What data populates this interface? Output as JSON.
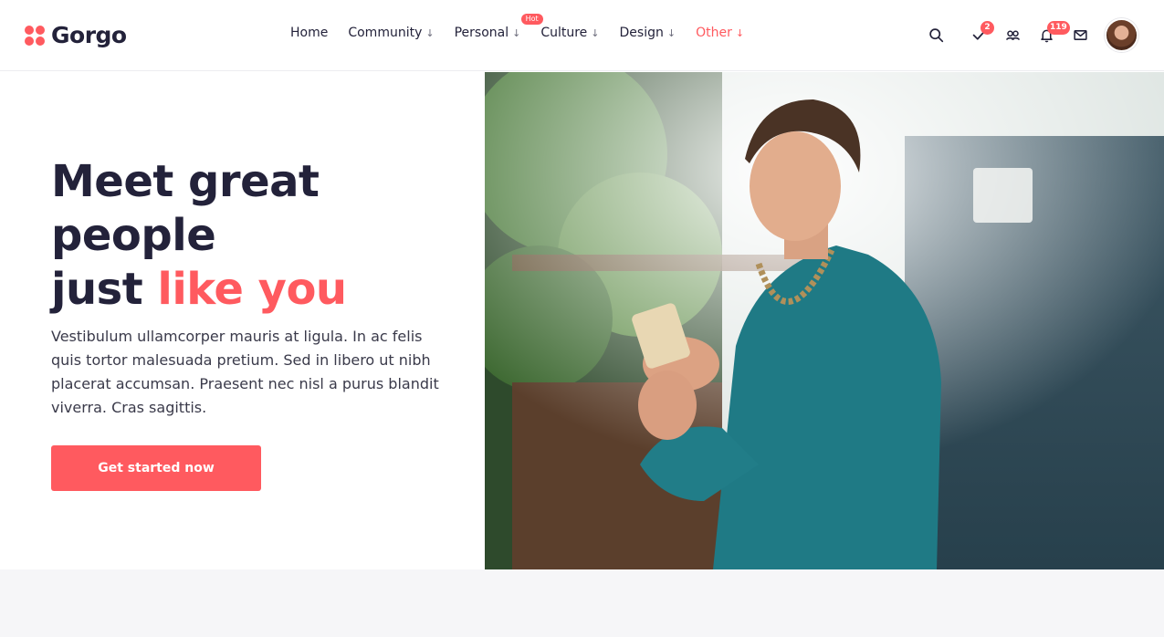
{
  "brand": {
    "name": "Gorgo",
    "color": "#ff5a5f"
  },
  "nav": {
    "items": [
      {
        "label": "Home",
        "has_dropdown": false
      },
      {
        "label": "Community",
        "has_dropdown": true
      },
      {
        "label": "Personal",
        "has_dropdown": true,
        "badge": "Hot"
      },
      {
        "label": "Culture",
        "has_dropdown": true
      },
      {
        "label": "Design",
        "has_dropdown": true
      },
      {
        "label": "Other",
        "has_dropdown": true,
        "highlighted": true
      }
    ],
    "dropdown_glyph": "↓"
  },
  "header_icons": {
    "search": {
      "icon": "search-icon"
    },
    "tasks": {
      "icon": "check-icon",
      "count": "2"
    },
    "friends": {
      "icon": "users-icon"
    },
    "notifications": {
      "icon": "bell-icon",
      "count": "119"
    },
    "messages": {
      "icon": "envelope-icon"
    },
    "profile": {
      "icon": "avatar"
    }
  },
  "hero": {
    "headline_line1": "Meet great",
    "headline_line2": "people",
    "headline_line3_plain": "just ",
    "headline_line3_accent": "like you",
    "description": "Vestibulum ullamcorper mauris at ligula. In ac felis quis tortor malesuada pretium. Sed in libero ut nibh placerat accumsan. Praesent nec nisl a purus blandit viverra. Cras sagittis.",
    "cta_label": "Get started now"
  },
  "colors": {
    "accent": "#ff5a5f",
    "heading": "#23223a",
    "body_text": "#3a3a4a",
    "band": "#f6f6f8"
  }
}
